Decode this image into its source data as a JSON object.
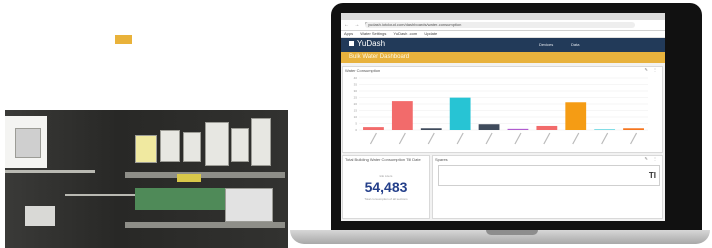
{
  "browser": {
    "url": "yudash.iotcloud.com/dashboards/water-consumption",
    "nav": "← → C",
    "bookmarks": [
      "Apps",
      "Water Settings",
      "YuDash .com",
      "Update"
    ]
  },
  "app": {
    "title": "YuDash",
    "nav": {
      "devices": "Devices",
      "data": "Data"
    },
    "page_title": "Bulk Water Dashboard"
  },
  "chart_widget": {
    "title": "Water Consumption",
    "tools": "✎ ⋮"
  },
  "chart_data": {
    "type": "bar",
    "categories": [
      "",
      "",
      "",
      "",
      "",
      "",
      "",
      "",
      "",
      "",
      "",
      ""
    ],
    "values": [
      2.5,
      25,
      1.5,
      28,
      5,
      1,
      3.5,
      24,
      0.5,
      1.5
    ],
    "colors": [
      "#f26b6b",
      "#f26b6b",
      "#3f4b5c",
      "#27c4d4",
      "#3f4b5c",
      "#b05ccf",
      "#f26b6b",
      "#f59c14",
      "#27c4d4",
      "#f5751f"
    ],
    "ylim": [
      0,
      45
    ],
    "yticks": [
      "40",
      "35",
      "30",
      "25",
      "20",
      "15",
      "10",
      "5",
      "0"
    ],
    "grid": true
  },
  "total_widget": {
    "title": "Total Building Water Consumption Till Date",
    "caption": "kilo Liters",
    "value": "54,483",
    "subtitle": "Total consumption of all sections"
  },
  "spares_widget": {
    "title": "Spares",
    "truncated": "TI"
  }
}
